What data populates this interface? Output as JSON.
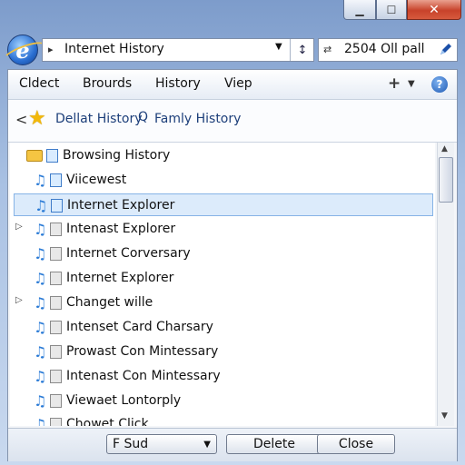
{
  "window": {
    "minimize_label": "▁",
    "maximize_label": "☐",
    "close_label": "✕"
  },
  "address": {
    "arrow": "▸",
    "value": "Internet History",
    "dropdown": "▼",
    "go": "↕"
  },
  "search": {
    "icon": "⇄",
    "value": "2504 Oll pall",
    "go_icon": "pen-icon"
  },
  "menu": {
    "items": [
      "Cldect",
      "Brourds",
      "History",
      "Viep"
    ],
    "add": "+",
    "add_drop": "▼",
    "help": "?"
  },
  "favorites": {
    "back": "<",
    "default_history": "Dellat History",
    "search_glyph": "Q",
    "family_history": "Famly History"
  },
  "list": {
    "rows": [
      {
        "label": "Browsing History",
        "kind": "folder",
        "expander": ""
      },
      {
        "label": "Viicewest",
        "kind": "page",
        "expander": ""
      },
      {
        "label": "Internet Explorer",
        "kind": "page",
        "expander": "",
        "selected": true
      },
      {
        "label": "Intenast Explorer",
        "kind": "page",
        "expander": "▷"
      },
      {
        "label": "Internet Corversary",
        "kind": "page",
        "expander": ""
      },
      {
        "label": "Internet Explorer",
        "kind": "page",
        "expander": ""
      },
      {
        "label": "Changet wille",
        "kind": "page",
        "expander": "▷"
      },
      {
        "label": "Intenset Card Charsary",
        "kind": "page",
        "expander": ""
      },
      {
        "label": "Prowast Con Mintessary",
        "kind": "page",
        "expander": ""
      },
      {
        "label": "Intenast Con Mintessary",
        "kind": "page",
        "expander": ""
      },
      {
        "label": "Viewaet Lontorply",
        "kind": "page",
        "expander": ""
      },
      {
        "label": "Chowet Click",
        "kind": "page",
        "expander": ""
      }
    ]
  },
  "scrollbar": {
    "up": "▲",
    "down": "▼"
  },
  "bottom": {
    "select_value": "F Sud",
    "select_drop": "▼",
    "delete_label": "Delete",
    "close_label": "Close"
  },
  "colors": {
    "selection": "#dcebfb",
    "link": "#1d3f7a",
    "close_button": "#c8422a"
  }
}
